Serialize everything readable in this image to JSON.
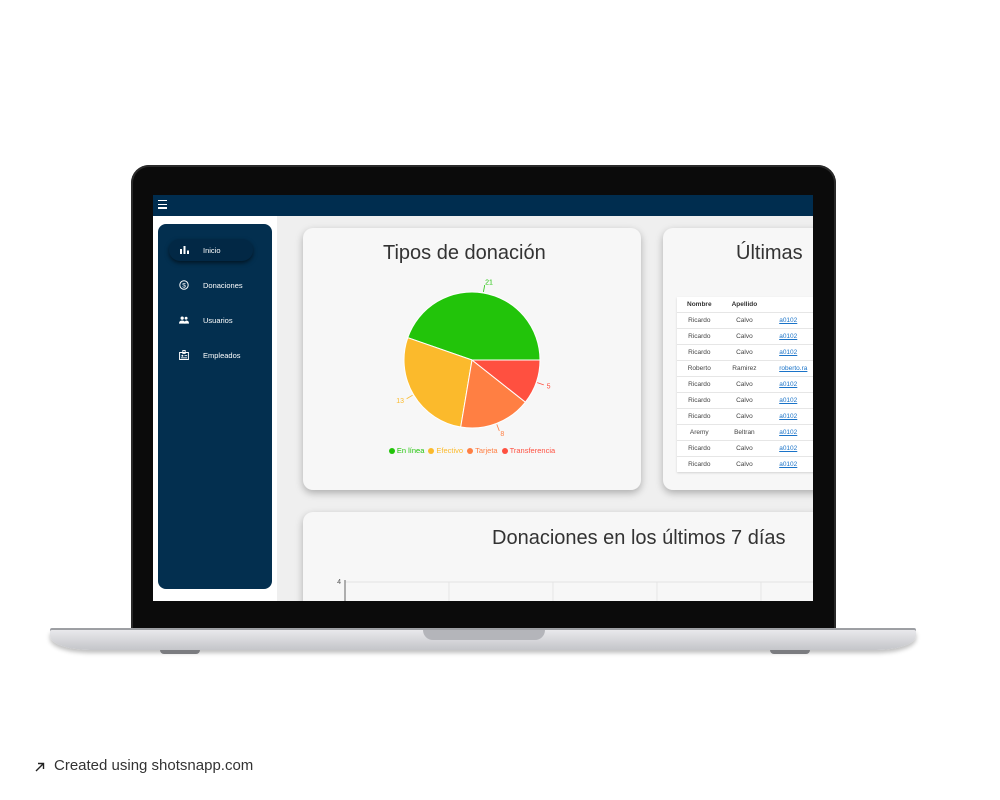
{
  "sidebar": {
    "items": [
      {
        "label": "Inicio",
        "icon": "bar-chart-icon"
      },
      {
        "label": "Donaciones",
        "icon": "dollar-circle-icon"
      },
      {
        "label": "Usuarios",
        "icon": "people-icon"
      },
      {
        "label": "Empleados",
        "icon": "badge-icon"
      }
    ]
  },
  "cards": {
    "donation_types_title": "Tipos de donación",
    "latest_title": "Últimas",
    "last7_title": "Donaciones en los últimos 7 días"
  },
  "chart_data": [
    {
      "type": "pie",
      "title": "Tipos de donación",
      "categories": [
        "En línea",
        "Efectivo",
        "Tarjeta",
        "Transferencia"
      ],
      "values": [
        21,
        13,
        8,
        5
      ],
      "colors": [
        "#22c40a",
        "#fbba2c",
        "#ff7f43",
        "#ff5040"
      ],
      "legend": "bottom"
    },
    {
      "type": "line",
      "title": "Donaciones en los últimos 7 días",
      "y_ticks_visible": [
        "4"
      ],
      "grid": true
    }
  ],
  "table": {
    "headers": [
      "Nombre",
      "Apellido",
      ""
    ],
    "rows": [
      [
        "Ricardo",
        "Calvo",
        "a0102"
      ],
      [
        "Ricardo",
        "Calvo",
        "a0102"
      ],
      [
        "Ricardo",
        "Calvo",
        "a0102"
      ],
      [
        "Roberto",
        "Ramirez",
        "roberto.ra"
      ],
      [
        "Ricardo",
        "Calvo",
        "a0102"
      ],
      [
        "Ricardo",
        "Calvo",
        "a0102"
      ],
      [
        "Ricardo",
        "Calvo",
        "a0102"
      ],
      [
        "Aremy",
        "Beltran",
        "a0102"
      ],
      [
        "Ricardo",
        "Calvo",
        "a0102"
      ],
      [
        "Ricardo",
        "Calvo",
        "a0102"
      ]
    ]
  },
  "footer": {
    "credit": "Created using shotsnapp.com",
    "arrow_icon": "arrow-up-right-icon"
  },
  "colors": {
    "topbar": "#002d4f",
    "sidebar": "#032f4f"
  }
}
